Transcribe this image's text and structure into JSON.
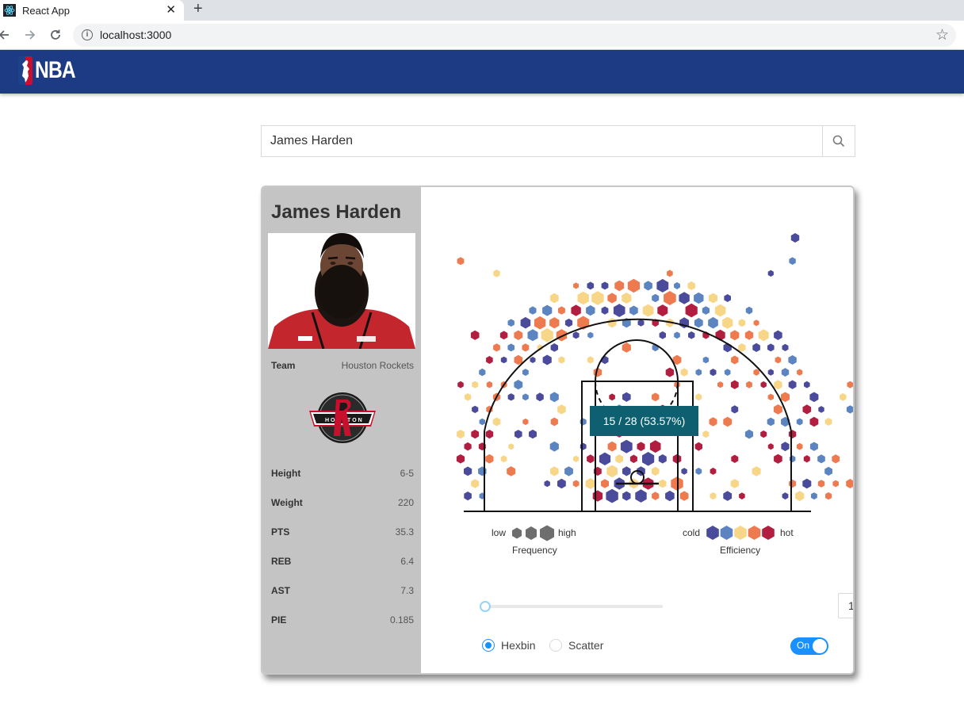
{
  "browser": {
    "tab_title": "React App",
    "tab_close": "✕",
    "new_tab": "+",
    "url": "localhost:3000"
  },
  "header": {
    "logo_text": "NBA"
  },
  "search": {
    "value": "James Harden"
  },
  "player": {
    "name": "James Harden",
    "team_label": "Team",
    "team_value": "Houston Rockets",
    "stats": [
      {
        "label": "Height",
        "value": "6-5"
      },
      {
        "label": "Weight",
        "value": "220"
      },
      {
        "label": "PTS",
        "value": "35.3"
      },
      {
        "label": "REB",
        "value": "6.4"
      },
      {
        "label": "AST",
        "value": "7.3"
      },
      {
        "label": "PIE",
        "value": "0.185"
      }
    ]
  },
  "shot_chart": {
    "tooltip": "15 / 28 (53.57%)",
    "frequency_legend": {
      "low": "low",
      "high": "high",
      "title": "Frequency"
    },
    "efficiency_legend": {
      "low": "cold",
      "high": "hot",
      "title": "Efficiency"
    },
    "efficiency_colors": [
      "#4a4b9a",
      "#5b84c0",
      "#f7d687",
      "#ee7a4f",
      "#b21e3f"
    ],
    "frequency_color": "#6e6e6e"
  },
  "controls": {
    "min_count": "1",
    "radio_hexbin": "Hexbin",
    "radio_scatter": "Scatter",
    "toggle_label": "On",
    "chart_mode": "Hexbin",
    "slider_value": 0
  }
}
